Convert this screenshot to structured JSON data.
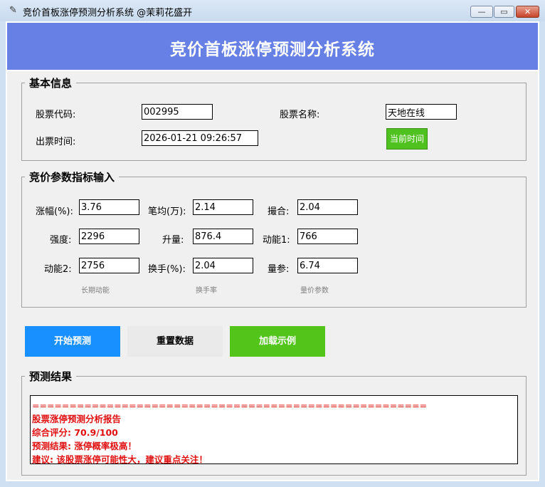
{
  "window": {
    "title": "竞价首板涨停预测分析系统 @茉莉花盛开",
    "min_glyph": "—",
    "max_glyph": "▭",
    "close_glyph": "✕"
  },
  "header": {
    "title": "竞价首板涨停预测分析系统"
  },
  "basic": {
    "legend": "基本信息",
    "code_label": "股票代码:",
    "code_value": "002995",
    "name_label": "股票名称:",
    "name_value": "天地在线",
    "time_label": "出票时间:",
    "time_value": "2026-01-21 09:26:57",
    "now_button": "当前时间"
  },
  "params": {
    "legend": "竞价参数指标输入",
    "fields": [
      {
        "label": "涨幅(%):",
        "value": "3.76"
      },
      {
        "label": "笔均(万):",
        "value": "2.14"
      },
      {
        "label": "撮合:",
        "value": "2.04"
      },
      {
        "label": "强度:",
        "value": "2296"
      },
      {
        "label": "升量:",
        "value": "876.4"
      },
      {
        "label": "动能1:",
        "value": "766"
      },
      {
        "label": "动能2:",
        "value": "2756"
      },
      {
        "label": "换手(%):",
        "value": "2.04"
      },
      {
        "label": "量参:",
        "value": "6.74"
      }
    ],
    "hints": [
      "长期动能",
      "换手率",
      "量价参数"
    ]
  },
  "buttons": {
    "start": "开始预测",
    "reset": "重置数据",
    "load": "加载示例"
  },
  "result": {
    "legend": "预测结果",
    "lines": [
      "=====================================================",
      "股票涨停预测分析报告",
      "综合评分: 70.9/100",
      "预测结果: 涨停概率极高！",
      "建议: 该股票涨停可能性大，建议重点关注！"
    ]
  },
  "colors": {
    "header_bg": "#6680e6",
    "start_bg": "#1890ff",
    "load_bg": "#52c41a",
    "now_bg": "#4fc21f",
    "result_text": "#e01010"
  }
}
